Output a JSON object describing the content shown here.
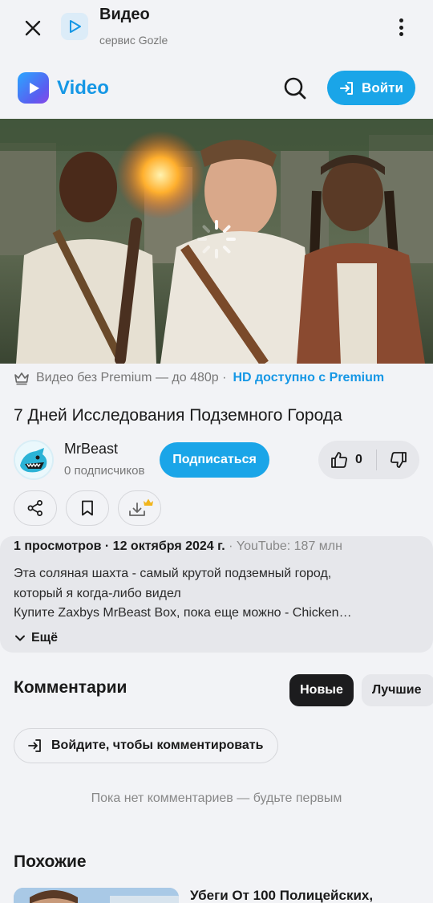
{
  "topbar": {
    "title": "Видео",
    "subtitle": "сервис Gozle"
  },
  "brand": {
    "name": "Video"
  },
  "header": {
    "login_label": "Войти"
  },
  "premium": {
    "notice": "Видео без Premium — до 480р ·",
    "hd_link": "HD доступно с Premium"
  },
  "video": {
    "title": "7 Дней Исследования Подземного Города"
  },
  "channel": {
    "name": "MrBeast",
    "subscribers": "0 подписчиков",
    "subscribe_label": "Подписаться",
    "likes": "0"
  },
  "description": {
    "views_date": "1 просмотров · 12 октября 2024 г.",
    "youtube_views": "· YouTube: 187 млн",
    "lines": [
      "Эта соляная шахта - самый крутой подземный город,",
      "который я когда-либо видел",
      "Купите Zaxbys MrBeast Box, пока еще можно - Chicken…"
    ],
    "more_label": "Ещё"
  },
  "comments": {
    "title": "Комментарии",
    "sort_new": "Новые",
    "sort_best": "Лучшие",
    "login_prompt": "Войдите, чтобы комментировать",
    "empty": "Пока нет комментариев — будьте первым"
  },
  "similar": {
    "title": "Похожие",
    "items": [
      {
        "title": "Убеги От 100 Полицейских,"
      }
    ]
  },
  "colors": {
    "accent": "#1aa5e8",
    "link": "#1597e5",
    "background": "#f2f3f6",
    "card": "#e6e7eb"
  },
  "icons": [
    "close-icon",
    "video-play-icon",
    "more-vertical-icon",
    "search-icon",
    "login-arrow-icon",
    "crown-icon",
    "thumbs-up-icon",
    "thumbs-down-icon",
    "share-icon",
    "bookmark-icon",
    "download-icon",
    "chevron-down-icon",
    "loading-spinner-icon"
  ]
}
